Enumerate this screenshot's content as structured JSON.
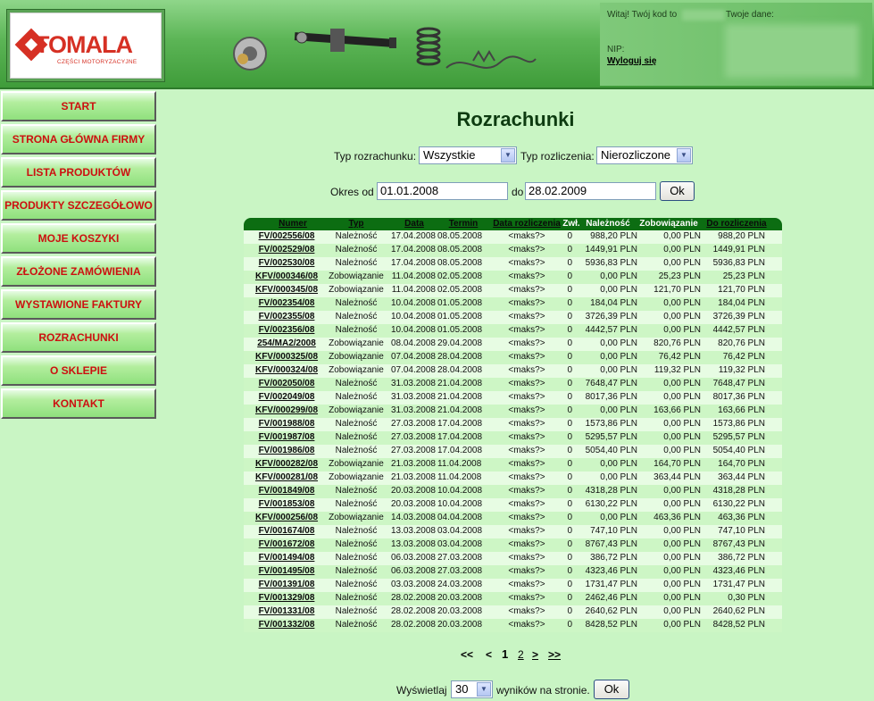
{
  "brand": {
    "name": "TOMALA",
    "subtitle": "CZĘŚCI MOTORYZACYJNE"
  },
  "user": {
    "greeting": "Witaj! Twój kod to",
    "data_label": "Twoje dane:",
    "nip_label": "NIP:",
    "logout": "Wyloguj się"
  },
  "nav": {
    "items": [
      {
        "label": "START"
      },
      {
        "label": "STRONA GŁÓWNA FIRMY"
      },
      {
        "label": "LISTA PRODUKTÓW"
      },
      {
        "label": "PRODUKTY SZCZEGÓŁOWO"
      },
      {
        "label": "MOJE KOSZYKI"
      },
      {
        "label": "ZŁOŻONE ZAMÓWIENIA"
      },
      {
        "label": "WYSTAWIONE FAKTURY"
      },
      {
        "label": "ROZRACHUNKI"
      },
      {
        "label": "O SKLEPIE"
      },
      {
        "label": "KONTAKT"
      }
    ]
  },
  "page": {
    "title": "Rozrachunki"
  },
  "filters": {
    "type_label": "Typ rozrachunku:",
    "type_value": "Wszystkie",
    "settle_label": "Typ rozliczenia:",
    "settle_value": "Nierozliczone",
    "from_label": "Okres od",
    "from_value": "01.01.2008",
    "to_label": "do",
    "to_value": "28.02.2009",
    "ok": "Ok"
  },
  "table": {
    "headers": [
      "Numer",
      "Typ",
      "Data",
      "Termin",
      "Data rozliczenia",
      "Zwł.",
      "Należność",
      "Zobowiązanie",
      "Do rozliczenia"
    ],
    "rows": [
      [
        "FV/002556/08",
        "Należność",
        "17.04.2008",
        "08.05.2008",
        "<maks?>",
        "0",
        "988,20 PLN",
        "0,00 PLN",
        "988,20 PLN"
      ],
      [
        "FV/002529/08",
        "Należność",
        "17.04.2008",
        "08.05.2008",
        "<maks?>",
        "0",
        "1449,91 PLN",
        "0,00 PLN",
        "1449,91 PLN"
      ],
      [
        "FV/002530/08",
        "Należność",
        "17.04.2008",
        "08.05.2008",
        "<maks?>",
        "0",
        "5936,83 PLN",
        "0,00 PLN",
        "5936,83 PLN"
      ],
      [
        "KFV/000346/08",
        "Zobowiązanie",
        "11.04.2008",
        "02.05.2008",
        "<maks?>",
        "0",
        "0,00 PLN",
        "25,23 PLN",
        "25,23 PLN"
      ],
      [
        "KFV/000345/08",
        "Zobowiązanie",
        "11.04.2008",
        "02.05.2008",
        "<maks?>",
        "0",
        "0,00 PLN",
        "121,70 PLN",
        "121,70 PLN"
      ],
      [
        "FV/002354/08",
        "Należność",
        "10.04.2008",
        "01.05.2008",
        "<maks?>",
        "0",
        "184,04 PLN",
        "0,00 PLN",
        "184,04 PLN"
      ],
      [
        "FV/002355/08",
        "Należność",
        "10.04.2008",
        "01.05.2008",
        "<maks?>",
        "0",
        "3726,39 PLN",
        "0,00 PLN",
        "3726,39 PLN"
      ],
      [
        "FV/002356/08",
        "Należność",
        "10.04.2008",
        "01.05.2008",
        "<maks?>",
        "0",
        "4442,57 PLN",
        "0,00 PLN",
        "4442,57 PLN"
      ],
      [
        "254/MA2/2008",
        "Zobowiązanie",
        "08.04.2008",
        "29.04.2008",
        "<maks?>",
        "0",
        "0,00 PLN",
        "820,76 PLN",
        "820,76 PLN"
      ],
      [
        "KFV/000325/08",
        "Zobowiązanie",
        "07.04.2008",
        "28.04.2008",
        "<maks?>",
        "0",
        "0,00 PLN",
        "76,42 PLN",
        "76,42 PLN"
      ],
      [
        "KFV/000324/08",
        "Zobowiązanie",
        "07.04.2008",
        "28.04.2008",
        "<maks?>",
        "0",
        "0,00 PLN",
        "119,32 PLN",
        "119,32 PLN"
      ],
      [
        "FV/002050/08",
        "Należność",
        "31.03.2008",
        "21.04.2008",
        "<maks?>",
        "0",
        "7648,47 PLN",
        "0,00 PLN",
        "7648,47 PLN"
      ],
      [
        "FV/002049/08",
        "Należność",
        "31.03.2008",
        "21.04.2008",
        "<maks?>",
        "0",
        "8017,36 PLN",
        "0,00 PLN",
        "8017,36 PLN"
      ],
      [
        "KFV/000299/08",
        "Zobowiązanie",
        "31.03.2008",
        "21.04.2008",
        "<maks?>",
        "0",
        "0,00 PLN",
        "163,66 PLN",
        "163,66 PLN"
      ],
      [
        "FV/001988/08",
        "Należność",
        "27.03.2008",
        "17.04.2008",
        "<maks?>",
        "0",
        "1573,86 PLN",
        "0,00 PLN",
        "1573,86 PLN"
      ],
      [
        "FV/001987/08",
        "Należność",
        "27.03.2008",
        "17.04.2008",
        "<maks?>",
        "0",
        "5295,57 PLN",
        "0,00 PLN",
        "5295,57 PLN"
      ],
      [
        "FV/001986/08",
        "Należność",
        "27.03.2008",
        "17.04.2008",
        "<maks?>",
        "0",
        "5054,40 PLN",
        "0,00 PLN",
        "5054,40 PLN"
      ],
      [
        "KFV/000282/08",
        "Zobowiązanie",
        "21.03.2008",
        "11.04.2008",
        "<maks?>",
        "0",
        "0,00 PLN",
        "164,70 PLN",
        "164,70 PLN"
      ],
      [
        "KFV/000281/08",
        "Zobowiązanie",
        "21.03.2008",
        "11.04.2008",
        "<maks?>",
        "0",
        "0,00 PLN",
        "363,44 PLN",
        "363,44 PLN"
      ],
      [
        "FV/001849/08",
        "Należność",
        "20.03.2008",
        "10.04.2008",
        "<maks?>",
        "0",
        "4318,28 PLN",
        "0,00 PLN",
        "4318,28 PLN"
      ],
      [
        "FV/001853/08",
        "Należność",
        "20.03.2008",
        "10.04.2008",
        "<maks?>",
        "0",
        "6130,22 PLN",
        "0,00 PLN",
        "6130,22 PLN"
      ],
      [
        "KFV/000256/08",
        "Zobowiązanie",
        "14.03.2008",
        "04.04.2008",
        "<maks?>",
        "0",
        "0,00 PLN",
        "463,36 PLN",
        "463,36 PLN"
      ],
      [
        "FV/001674/08",
        "Należność",
        "13.03.2008",
        "03.04.2008",
        "<maks?>",
        "0",
        "747,10 PLN",
        "0,00 PLN",
        "747,10 PLN"
      ],
      [
        "FV/001672/08",
        "Należność",
        "13.03.2008",
        "03.04.2008",
        "<maks?>",
        "0",
        "8767,43 PLN",
        "0,00 PLN",
        "8767,43 PLN"
      ],
      [
        "FV/001494/08",
        "Należność",
        "06.03.2008",
        "27.03.2008",
        "<maks?>",
        "0",
        "386,72 PLN",
        "0,00 PLN",
        "386,72 PLN"
      ],
      [
        "FV/001495/08",
        "Należność",
        "06.03.2008",
        "27.03.2008",
        "<maks?>",
        "0",
        "4323,46 PLN",
        "0,00 PLN",
        "4323,46 PLN"
      ],
      [
        "FV/001391/08",
        "Należność",
        "03.03.2008",
        "24.03.2008",
        "<maks?>",
        "0",
        "1731,47 PLN",
        "0,00 PLN",
        "1731,47 PLN"
      ],
      [
        "FV/001329/08",
        "Należność",
        "28.02.2008",
        "20.03.2008",
        "<maks?>",
        "0",
        "2462,46 PLN",
        "0,00 PLN",
        "0,30 PLN"
      ],
      [
        "FV/001331/08",
        "Należność",
        "28.02.2008",
        "20.03.2008",
        "<maks?>",
        "0",
        "2640,62 PLN",
        "0,00 PLN",
        "2640,62 PLN"
      ],
      [
        "FV/001332/08",
        "Należność",
        "28.02.2008",
        "20.03.2008",
        "<maks?>",
        "0",
        "8428,52 PLN",
        "0,00 PLN",
        "8428,52 PLN"
      ]
    ]
  },
  "pager": {
    "first": "<<",
    "prev": "<",
    "current": "1",
    "page2": "2",
    "next": ">",
    "last": ">>"
  },
  "perpage": {
    "label": "Wyświetlaj",
    "value": "30",
    "suffix": "wyników na stronie.",
    "ok": "Ok"
  }
}
